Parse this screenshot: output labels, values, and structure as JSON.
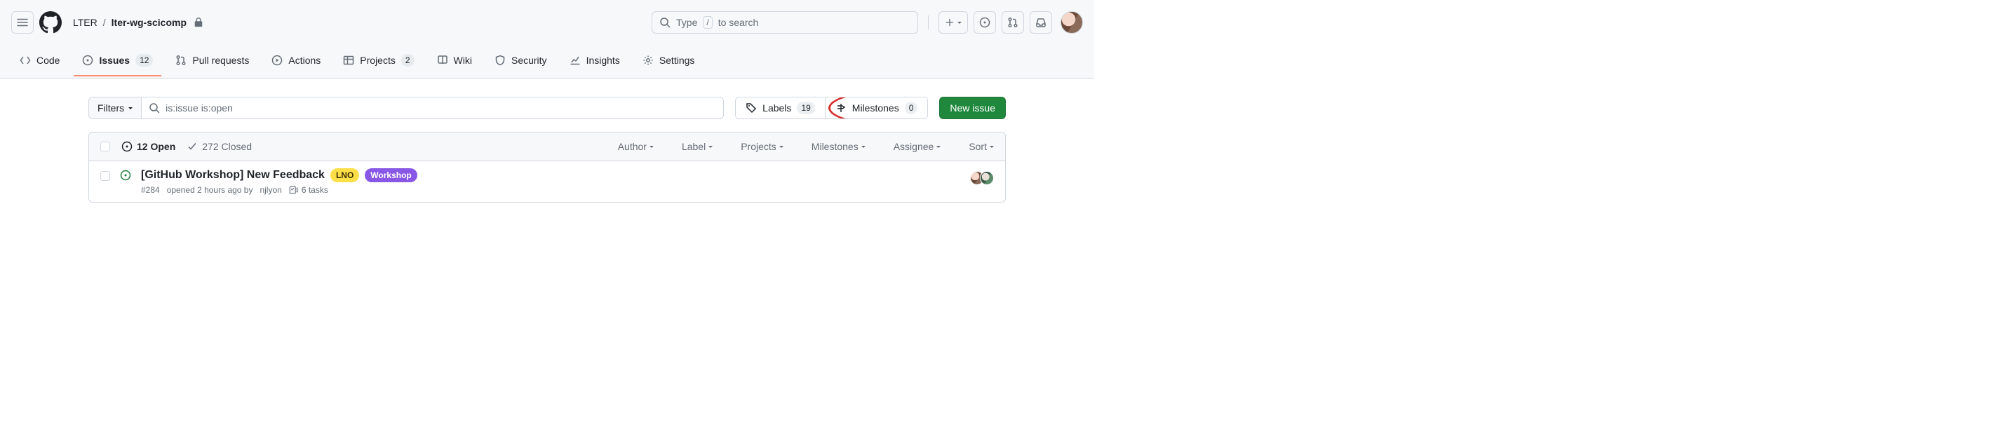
{
  "header": {
    "owner": "LTER",
    "repo": "lter-wg-scicomp",
    "search_before": "Type",
    "search_key": "/",
    "search_after": "to search"
  },
  "nav": {
    "code": "Code",
    "issues": "Issues",
    "issues_count": "12",
    "pulls": "Pull requests",
    "actions": "Actions",
    "projects": "Projects",
    "projects_count": "2",
    "wiki": "Wiki",
    "security": "Security",
    "insights": "Insights",
    "settings": "Settings"
  },
  "filters": {
    "button": "Filters",
    "query": "is:issue is:open",
    "labels": "Labels",
    "labels_count": "19",
    "milestones": "Milestones",
    "milestones_count": "0",
    "new_issue": "New issue"
  },
  "list_header": {
    "open": "12 Open",
    "closed": "272 Closed",
    "dd_author": "Author",
    "dd_label": "Label",
    "dd_projects": "Projects",
    "dd_milestones": "Milestones",
    "dd_assignee": "Assignee",
    "dd_sort": "Sort"
  },
  "issues": [
    {
      "title": "[GitHub Workshop] New Feedback",
      "labels": [
        {
          "text": "LNO",
          "bg": "#fddf47",
          "fg": "#3d2e00"
        },
        {
          "text": "Workshop",
          "bg": "#8957e5",
          "fg": "#ffffff"
        }
      ],
      "meta_number": "#284",
      "meta_opened": "opened 2 hours ago by",
      "meta_author": "njlyon",
      "tasks": "6 tasks",
      "assignees": 2
    }
  ]
}
